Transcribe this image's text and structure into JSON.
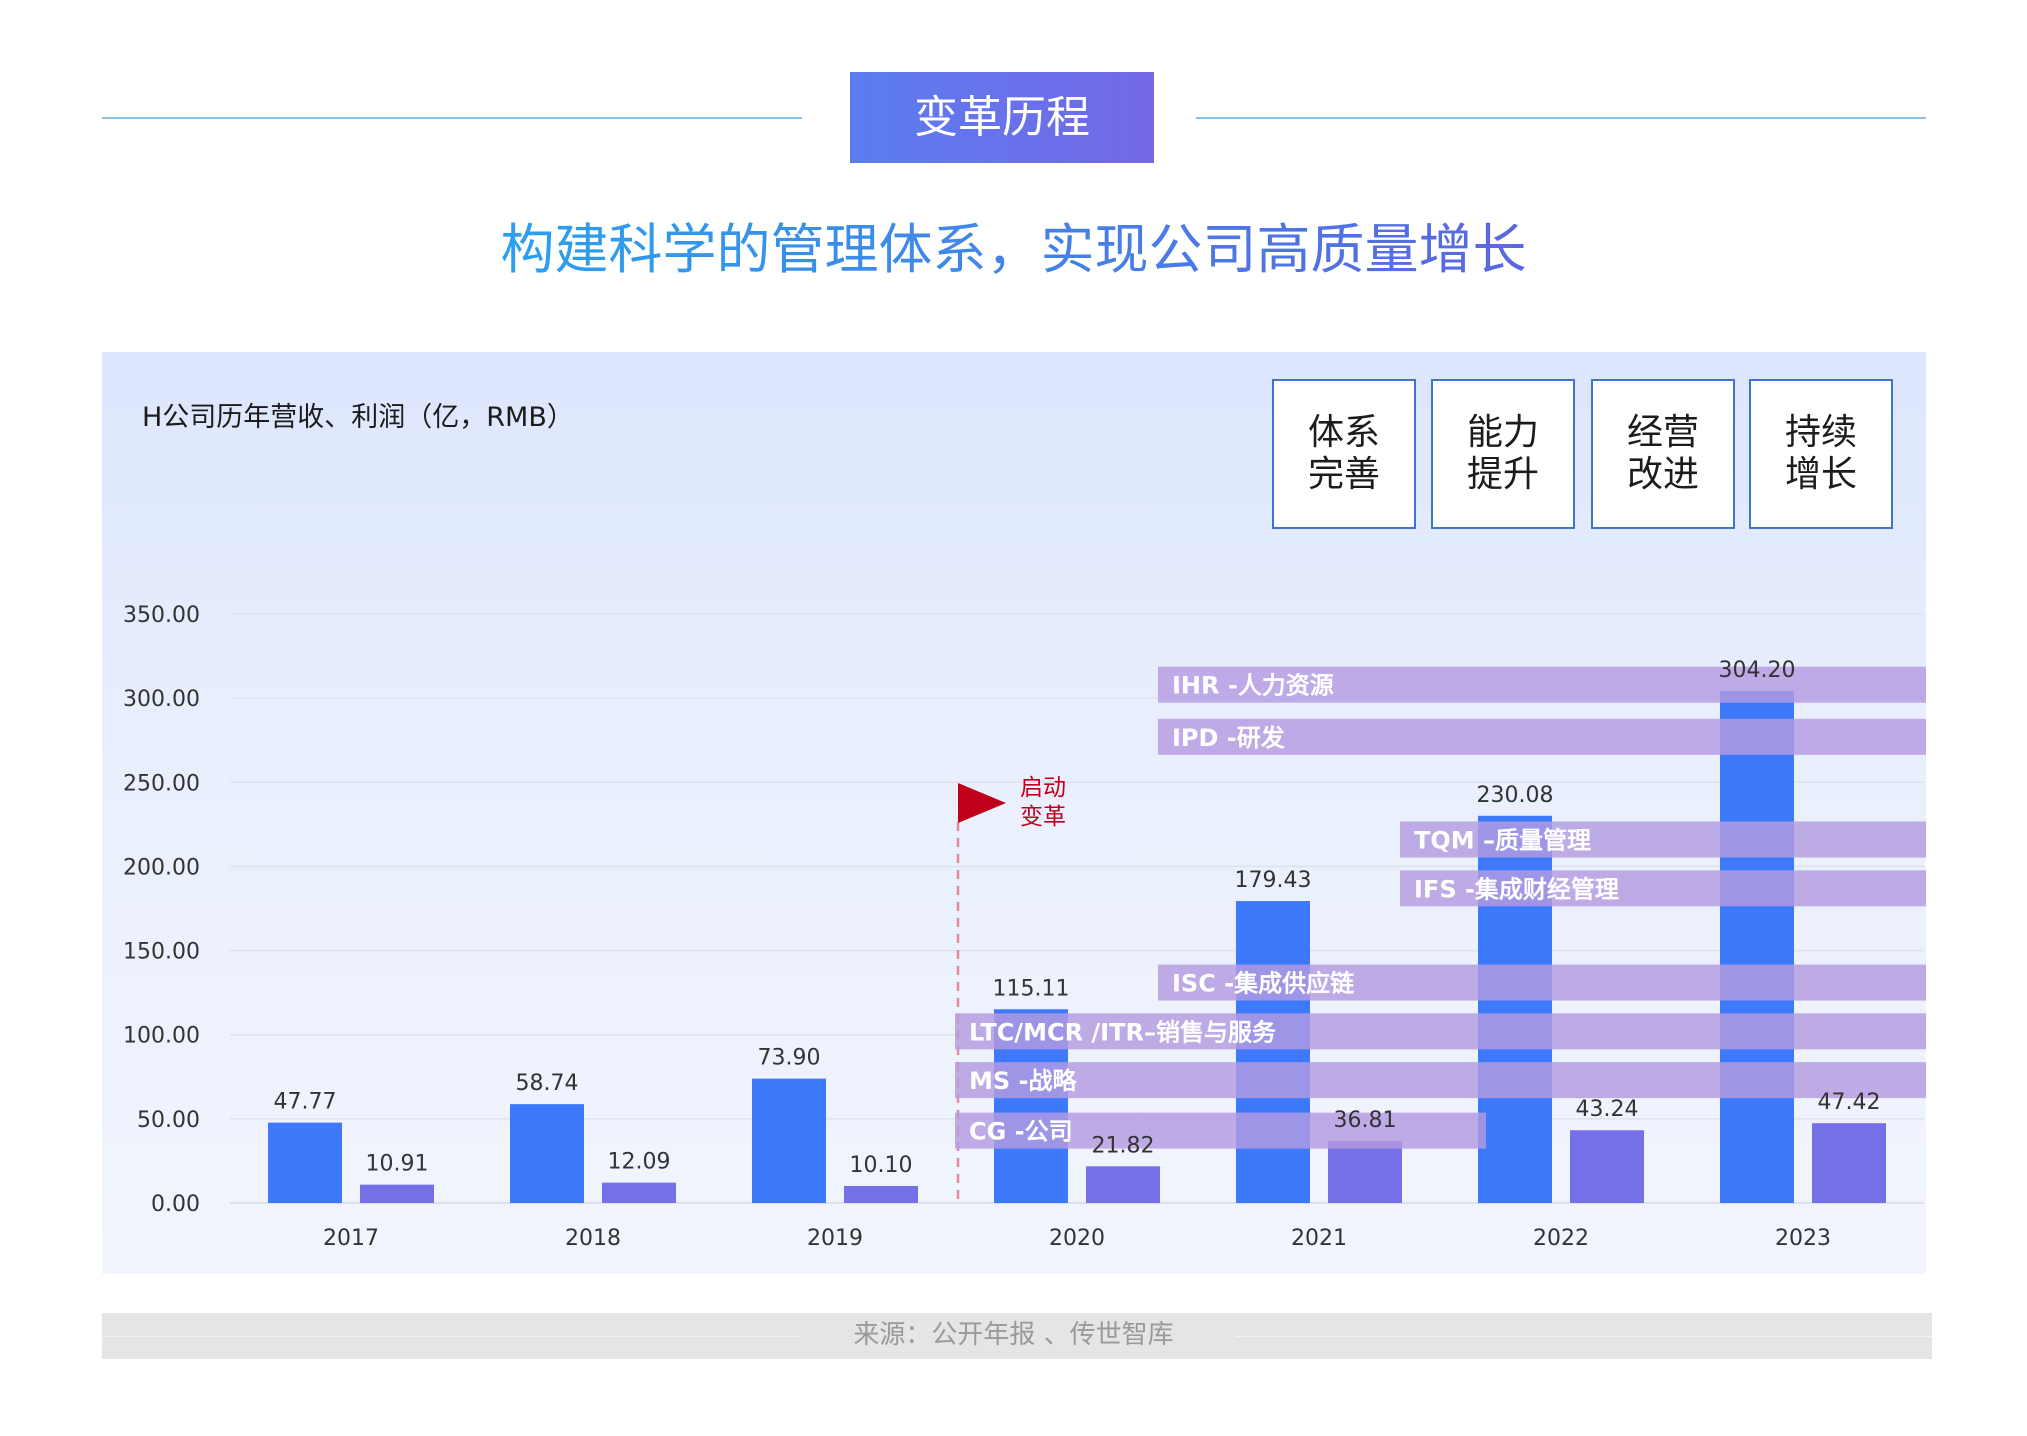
{
  "header": {
    "banner": "变革历程",
    "headline": "构建科学的管理体系，实现公司高质量增长"
  },
  "steps": [
    {
      "label": "体系\n完善"
    },
    {
      "label": "能力\n提升"
    },
    {
      "label": "经营\n改进"
    },
    {
      "label": "持续\n增长"
    }
  ],
  "milestone": {
    "label_line1": "启动",
    "label_line2": "变革",
    "year_boundary": "2019-2020"
  },
  "source": "来源：公开年报 、传世智库",
  "colors": {
    "revenue": "#3e79fb",
    "profit": "#7670e8",
    "band": "#b39be0",
    "band_text": "#ffffff",
    "flag": "#c0001b",
    "milestone_line": "#e08a9a",
    "banner_start": "#5b7cf0",
    "banner_end": "#7468e6"
  },
  "chart_data": {
    "type": "bar",
    "title": "H公司历年营收、利润（亿，RMB）",
    "categories": [
      "2017",
      "2018",
      "2019",
      "2020",
      "2021",
      "2022",
      "2023"
    ],
    "series": [
      {
        "values": [
          47.77,
          58.74,
          73.9,
          115.11,
          179.43,
          230.08,
          304.2
        ],
        "labels": [
          "47.77",
          "58.74",
          "73.90",
          "115.11",
          "179.43",
          "230.08",
          "304.20"
        ]
      },
      {
        "values": [
          10.91,
          12.09,
          10.1,
          21.82,
          36.81,
          43.24,
          47.42
        ],
        "labels": [
          "10.91",
          "12.09",
          "10.10",
          "21.82",
          "36.81",
          "43.24",
          "47.42"
        ]
      }
    ],
    "ylim": [
      0,
      350
    ],
    "yticks": [
      "0.00",
      "50.00",
      "100.00",
      "150.00",
      "200.00",
      "250.00",
      "300.00",
      "350.00"
    ],
    "grid": true,
    "legend": "none",
    "annotations": [
      {
        "label": "IHR -人力资源",
        "value": 308,
        "from": "2021"
      },
      {
        "label": "IPD -研发",
        "value": 277,
        "from": "2021"
      },
      {
        "label": "TQM –质量管理",
        "value": 216,
        "from": "2022"
      },
      {
        "label": "IFS -集成财经管理",
        "value": 187,
        "from": "2022"
      },
      {
        "label": "ISC -集成供应链",
        "value": 131,
        "from": "2021"
      },
      {
        "label": "LTC/MCR /ITR–销售与服务",
        "value": 102,
        "from": "2020"
      },
      {
        "label": "MS -战略",
        "value": 73,
        "from": "2020"
      },
      {
        "label": "CG -公司",
        "value": 43,
        "from": "2020",
        "to": "2022"
      }
    ]
  }
}
